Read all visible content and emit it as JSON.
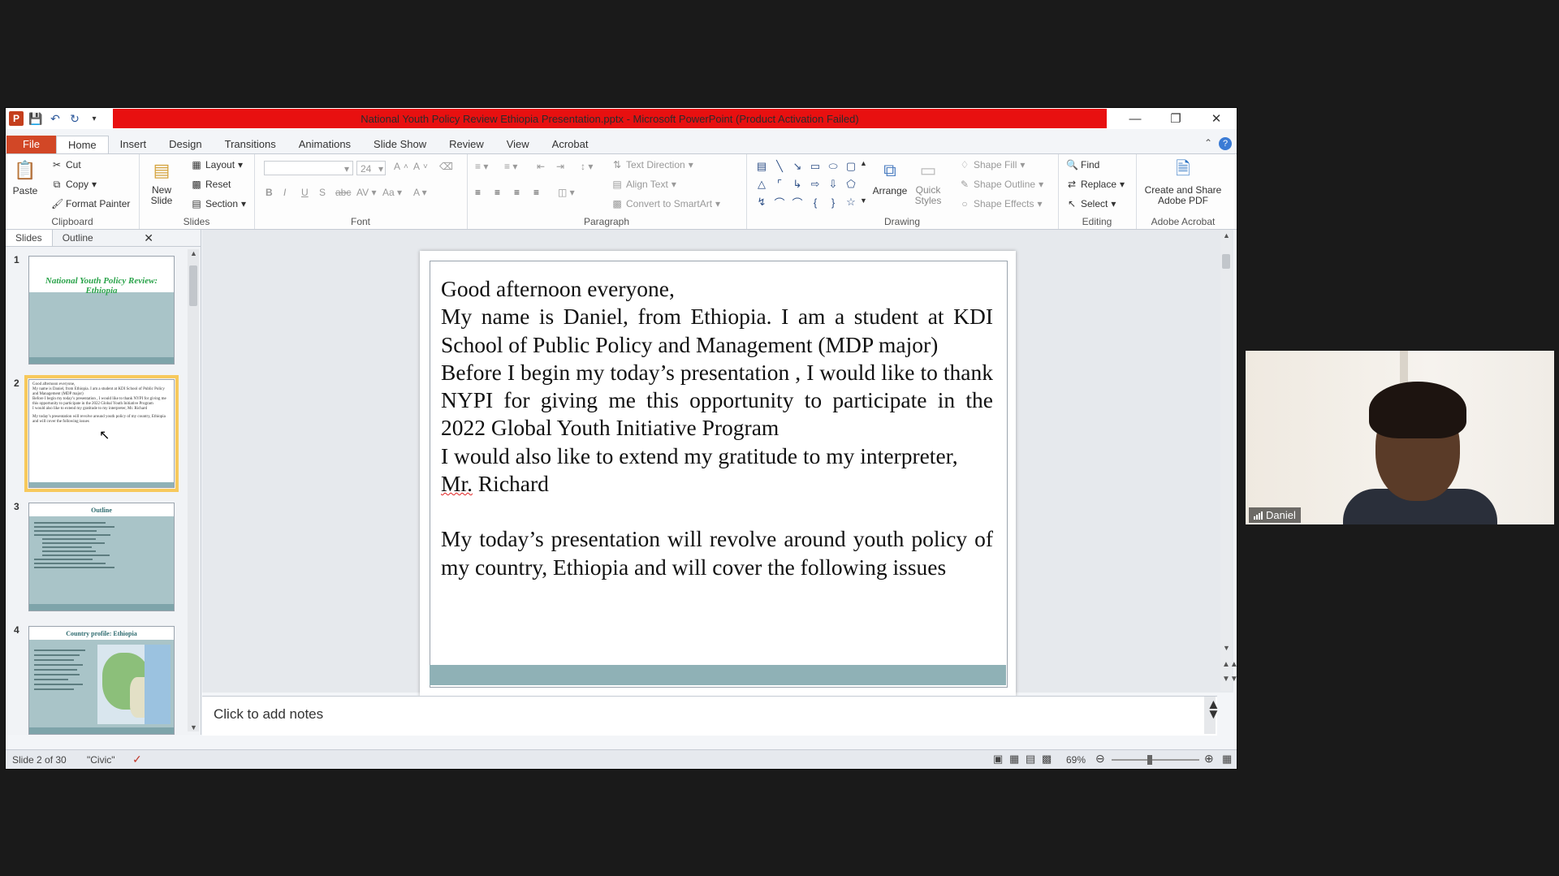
{
  "window": {
    "title": "National Youth Policy Review Ethiopia Presentation.pptx  -  Microsoft PowerPoint (Product Activation Failed)"
  },
  "tabs": [
    "File",
    "Home",
    "Insert",
    "Design",
    "Transitions",
    "Animations",
    "Slide Show",
    "Review",
    "View",
    "Acrobat"
  ],
  "ribbon": {
    "clipboard": {
      "paste": "Paste",
      "cut": "Cut",
      "copy": "Copy",
      "format_painter": "Format Painter",
      "label": "Clipboard"
    },
    "slides": {
      "new_slide": "New Slide",
      "layout": "Layout",
      "reset": "Reset",
      "section": "Section",
      "label": "Slides"
    },
    "font": {
      "size": "24",
      "label": "Font"
    },
    "paragraph": {
      "text_direction": "Text Direction",
      "align_text": "Align Text",
      "convert_smartart": "Convert to SmartArt",
      "label": "Paragraph"
    },
    "drawing": {
      "arrange": "Arrange",
      "quick_styles": "Quick Styles",
      "shape_fill": "Shape Fill",
      "shape_outline": "Shape Outline",
      "shape_effects": "Shape Effects",
      "label": "Drawing"
    },
    "editing": {
      "find": "Find",
      "replace": "Replace",
      "select": "Select",
      "label": "Editing"
    },
    "acrobat": {
      "create": "Create and Share Adobe PDF",
      "label": "Adobe Acrobat"
    }
  },
  "left_panel": {
    "tabs": [
      "Slides",
      "Outline"
    ],
    "thumbs": [
      {
        "num": "1",
        "title": "National Youth Policy Review: Ethiopia"
      },
      {
        "num": "2",
        "title": ""
      },
      {
        "num": "3",
        "title": "Outline"
      },
      {
        "num": "4",
        "title": "Country profile: Ethiopia"
      }
    ]
  },
  "slide": {
    "lines": [
      "Good afternoon everyone,",
      "My name is Daniel, from Ethiopia. I am a student at KDI School of Public Policy and Management (MDP major)",
      "Before I begin my today’s presentation , I would like to thank NYPI for giving me this opportunity to participate in the 2022 Global Youth Initiative Program",
      "I would also like to extend my gratitude to my interpreter,",
      "Mr.",
      " Richard",
      "My today’s presentation will revolve around youth policy of my country, Ethiopia and will cover the following issues"
    ]
  },
  "notes": {
    "placeholder": "Click to add notes"
  },
  "status": {
    "slide": "Slide 2 of 30",
    "theme": "\"Civic\"",
    "zoom": "69%"
  },
  "webcam": {
    "name": "Daniel"
  }
}
